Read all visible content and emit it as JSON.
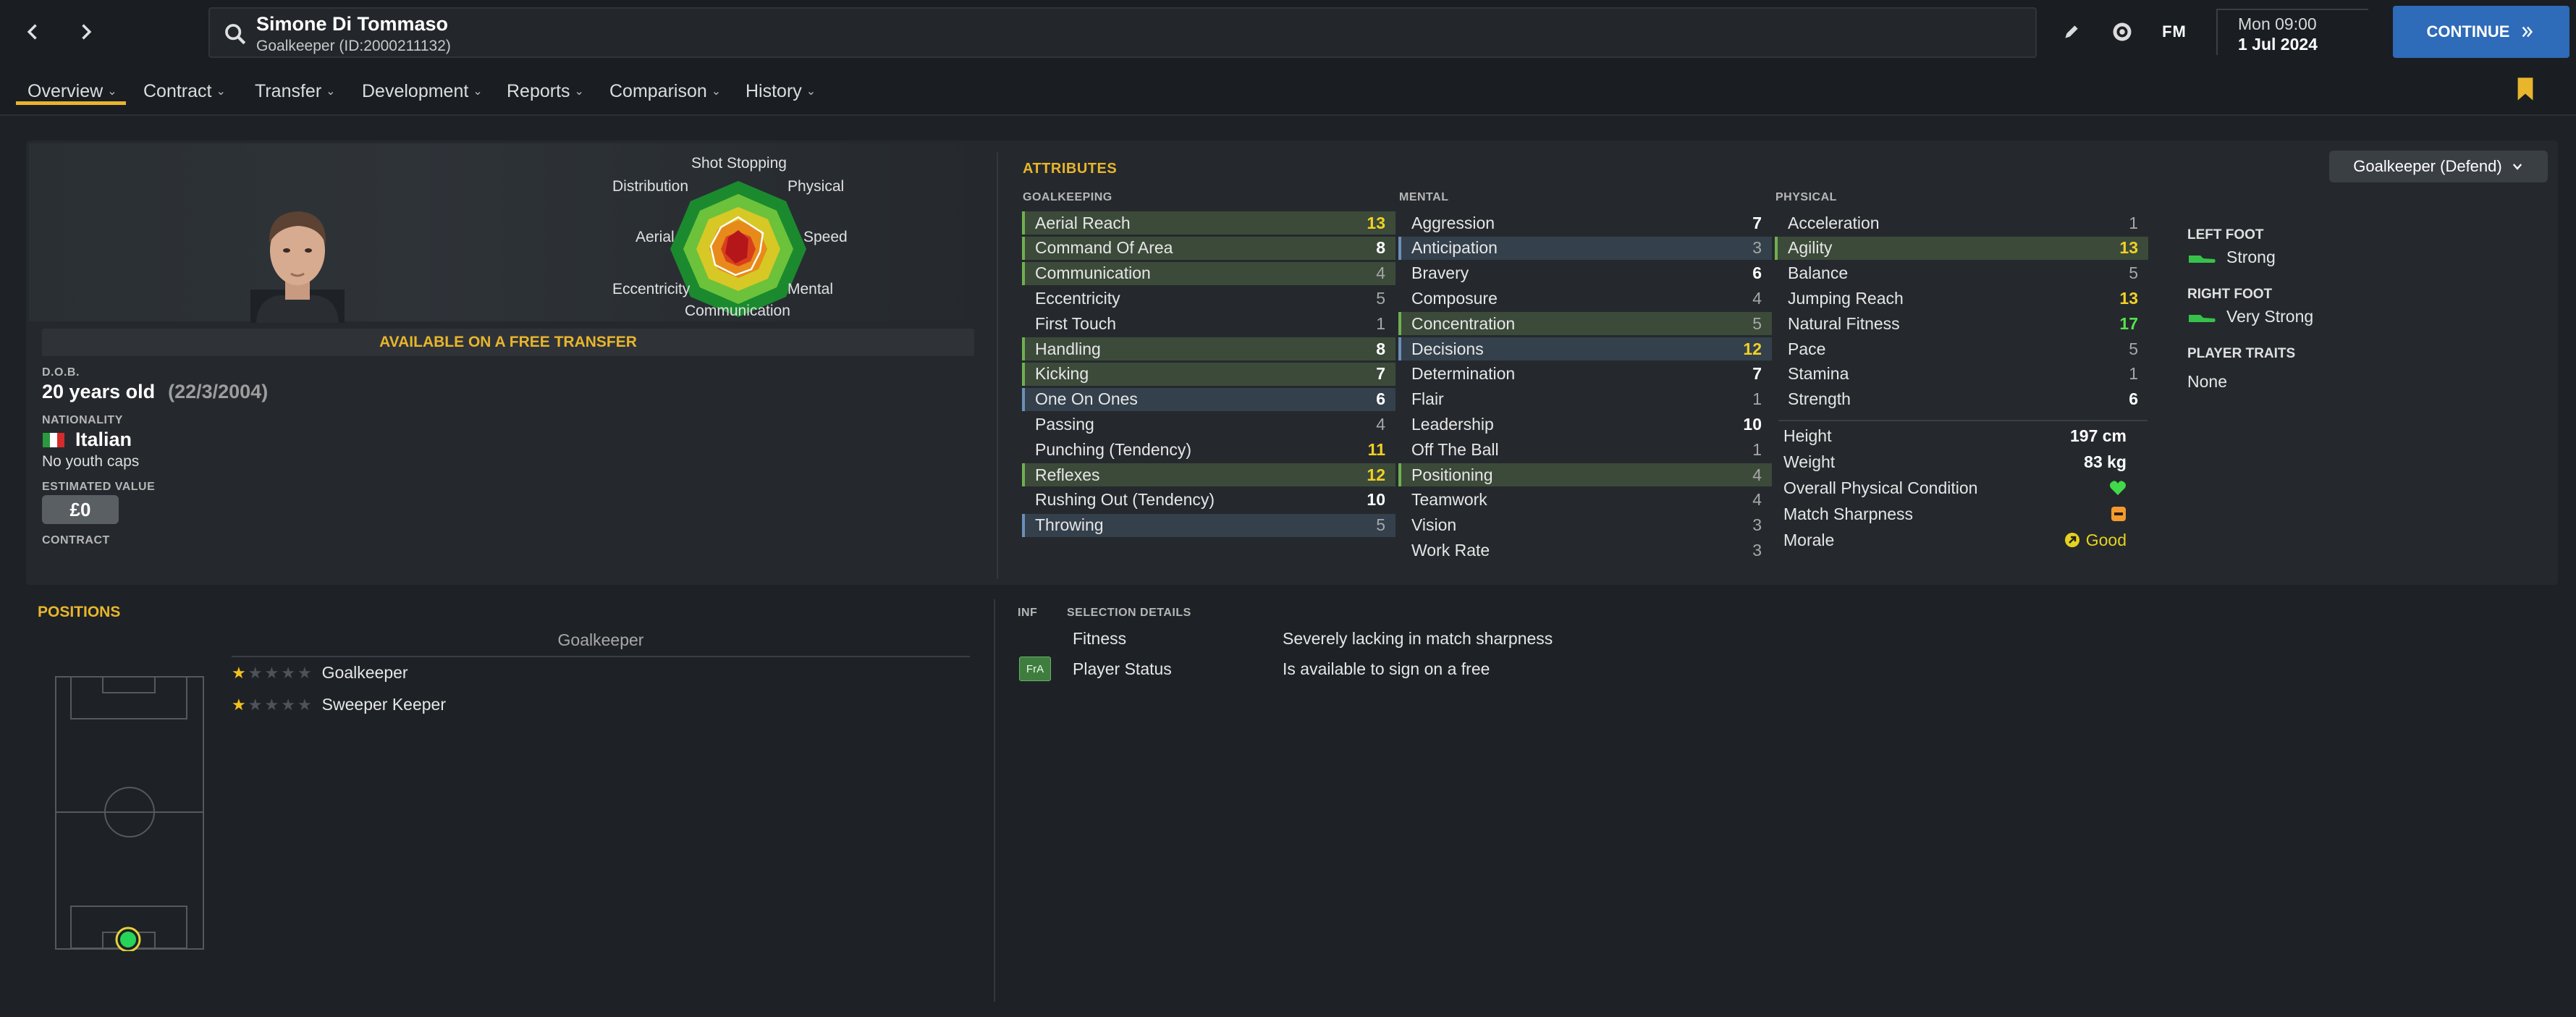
{
  "header": {
    "player_name": "Simone Di Tommaso",
    "player_subtitle": "Goalkeeper (ID:2000211132)",
    "fm_label": "FM",
    "date_day": "Mon 09:00",
    "date_full": "1 Jul 2024",
    "continue_label": "CONTINUE"
  },
  "tabs": [
    {
      "label": "Overview"
    },
    {
      "label": "Contract"
    },
    {
      "label": "Transfer"
    },
    {
      "label": "Development"
    },
    {
      "label": "Reports"
    },
    {
      "label": "Comparison"
    },
    {
      "label": "History"
    }
  ],
  "profile": {
    "availability": "AVAILABLE ON A FREE TRANSFER",
    "dob_label": "D.O.B.",
    "age": "20 years old",
    "dob": "(22/3/2004)",
    "nationality_label": "NATIONALITY",
    "nationality": "Italian",
    "youth_caps": "No youth caps",
    "value_label": "ESTIMATED VALUE",
    "value": "£0",
    "contract_label": "CONTRACT"
  },
  "radar": {
    "labels": {
      "shot_stopping": "Shot Stopping",
      "physical": "Physical",
      "speed": "Speed",
      "mental": "Mental",
      "communication": "Communication",
      "eccentricity": "Eccentricity",
      "aerial": "Aerial",
      "distribution": "Distribution"
    }
  },
  "attributes": {
    "title": "ATTRIBUTES",
    "role_select": "Goalkeeper (Defend)",
    "goalkeeping": {
      "header": "GOALKEEPING",
      "rows": [
        {
          "name": "Aerial Reach",
          "value": "13",
          "hl": "g",
          "color": "yellow"
        },
        {
          "name": "Command Of Area",
          "value": "8",
          "hl": "g",
          "color": "white"
        },
        {
          "name": "Communication",
          "value": "4",
          "hl": "g",
          "color": "grey"
        },
        {
          "name": "Eccentricity",
          "value": "5",
          "hl": "",
          "color": "grey"
        },
        {
          "name": "First Touch",
          "value": "1",
          "hl": "",
          "color": "grey"
        },
        {
          "name": "Handling",
          "value": "8",
          "hl": "g",
          "color": "white"
        },
        {
          "name": "Kicking",
          "value": "7",
          "hl": "g",
          "color": "white"
        },
        {
          "name": "One On Ones",
          "value": "6",
          "hl": "b",
          "color": "white"
        },
        {
          "name": "Passing",
          "value": "4",
          "hl": "",
          "color": "grey"
        },
        {
          "name": "Punching (Tendency)",
          "value": "11",
          "hl": "",
          "color": "yellow"
        },
        {
          "name": "Reflexes",
          "value": "12",
          "hl": "g",
          "color": "yellow"
        },
        {
          "name": "Rushing Out (Tendency)",
          "value": "10",
          "hl": "",
          "color": "white"
        },
        {
          "name": "Throwing",
          "value": "5",
          "hl": "b",
          "color": "grey"
        }
      ]
    },
    "mental": {
      "header": "MENTAL",
      "rows": [
        {
          "name": "Aggression",
          "value": "7",
          "hl": "",
          "color": "white"
        },
        {
          "name": "Anticipation",
          "value": "3",
          "hl": "b",
          "color": "grey"
        },
        {
          "name": "Bravery",
          "value": "6",
          "hl": "",
          "color": "white"
        },
        {
          "name": "Composure",
          "value": "4",
          "hl": "",
          "color": "grey"
        },
        {
          "name": "Concentration",
          "value": "5",
          "hl": "g",
          "color": "grey"
        },
        {
          "name": "Decisions",
          "value": "12",
          "hl": "b",
          "color": "yellow"
        },
        {
          "name": "Determination",
          "value": "7",
          "hl": "",
          "color": "white"
        },
        {
          "name": "Flair",
          "value": "1",
          "hl": "",
          "color": "grey"
        },
        {
          "name": "Leadership",
          "value": "10",
          "hl": "",
          "color": "white"
        },
        {
          "name": "Off The Ball",
          "value": "1",
          "hl": "",
          "color": "grey"
        },
        {
          "name": "Positioning",
          "value": "4",
          "hl": "g",
          "color": "grey"
        },
        {
          "name": "Teamwork",
          "value": "4",
          "hl": "",
          "color": "grey"
        },
        {
          "name": "Vision",
          "value": "3",
          "hl": "",
          "color": "grey"
        },
        {
          "name": "Work Rate",
          "value": "3",
          "hl": "",
          "color": "grey"
        }
      ]
    },
    "physical": {
      "header": "PHYSICAL",
      "rows": [
        {
          "name": "Acceleration",
          "value": "1",
          "hl": "",
          "color": "grey"
        },
        {
          "name": "Agility",
          "value": "13",
          "hl": "g",
          "color": "yellow"
        },
        {
          "name": "Balance",
          "value": "5",
          "hl": "",
          "color": "grey"
        },
        {
          "name": "Jumping Reach",
          "value": "13",
          "hl": "",
          "color": "yellow"
        },
        {
          "name": "Natural Fitness",
          "value": "17",
          "hl": "",
          "color": "green"
        },
        {
          "name": "Pace",
          "value": "5",
          "hl": "",
          "color": "grey"
        },
        {
          "name": "Stamina",
          "value": "1",
          "hl": "",
          "color": "grey"
        },
        {
          "name": "Strength",
          "value": "6",
          "hl": "",
          "color": "white"
        }
      ]
    },
    "physical_info": {
      "height_label": "Height",
      "height": "197 cm",
      "weight_label": "Weight",
      "weight": "83 kg",
      "condition_label": "Overall Physical Condition",
      "sharpness_label": "Match Sharpness",
      "morale_label": "Morale",
      "morale": "Good"
    }
  },
  "feet": {
    "left_label": "LEFT FOOT",
    "left_value": "Strong",
    "right_label": "RIGHT FOOT",
    "right_value": "Very Strong",
    "traits_label": "PLAYER TRAITS",
    "traits_value": "None"
  },
  "positions": {
    "title": "POSITIONS",
    "group": "Goalkeeper",
    "items": [
      {
        "label": "Goalkeeper",
        "stars": 1
      },
      {
        "label": "Sweeper Keeper",
        "stars": 1
      }
    ]
  },
  "selection": {
    "inf_header": "INF",
    "header": "SELECTION DETAILS",
    "rows": [
      {
        "badge": "",
        "label": "Fitness",
        "value": "Severely lacking in match sharpness"
      },
      {
        "badge": "FrA",
        "label": "Player Status",
        "value": "Is available to sign on a free"
      }
    ]
  },
  "colors": {
    "accent": "#e8b52c",
    "continue": "#2e6bb8",
    "highlight_green": "#3c4a3a",
    "highlight_blue": "#34404c"
  }
}
